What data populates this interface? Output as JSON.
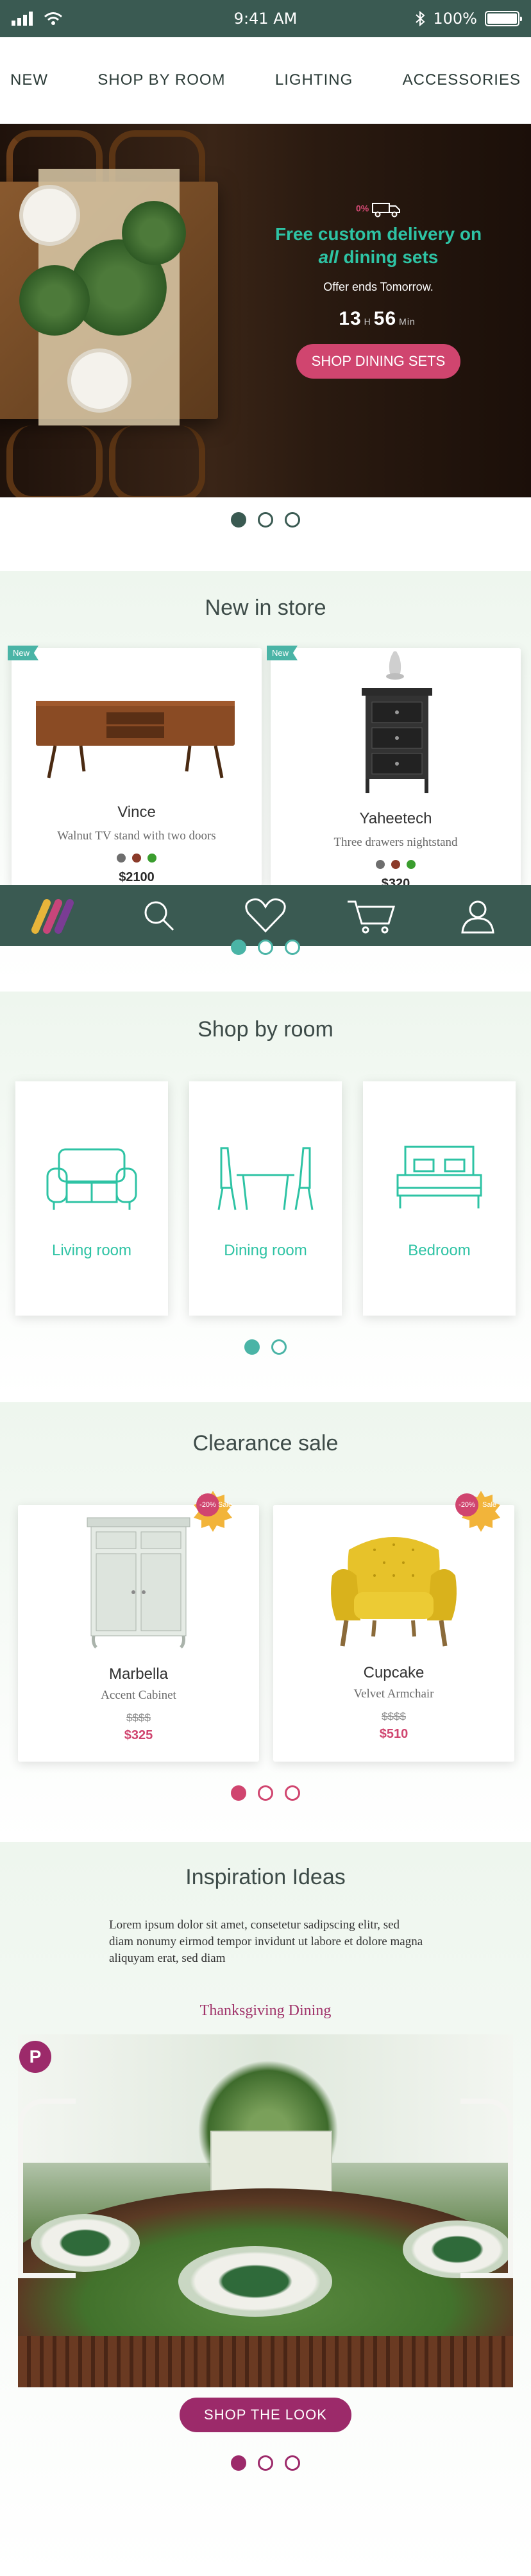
{
  "status_bar": {
    "time": "9:41 AM",
    "battery": "100%"
  },
  "nav": {
    "items": [
      "NEW",
      "SHOP BY ROOM",
      "LIGHTING",
      "ACCESSORIES"
    ]
  },
  "hero": {
    "badge": "0%",
    "headline_line1": "Free custom delivery on",
    "headline_line2_italic": "all",
    "headline_line2_rest": " dining sets",
    "sub": "Offer ends Tomorrow.",
    "hours": "13",
    "hours_unit": "H",
    "minutes": "56",
    "minutes_unit": "Min",
    "cta": "SHOP DINING SETS"
  },
  "new_in_store": {
    "title": "New in store",
    "products": [
      {
        "badge": "New",
        "name": "Vince",
        "desc": "Walnut TV stand with two doors",
        "price": "$2100",
        "swatch_colors": [
          "#6e6e6e",
          "#8b3b2a",
          "#3a9d2e"
        ]
      },
      {
        "badge": "New",
        "name": "Yaheetech",
        "desc": "Three drawers nightstand",
        "price": "$320",
        "swatch_colors": [
          "#6e6e6e",
          "#8b3b2a",
          "#3a9d2e"
        ]
      }
    ]
  },
  "tabbar": {
    "icons": [
      "app-logo-icon",
      "search-icon",
      "heart-icon",
      "cart-icon",
      "user-icon"
    ]
  },
  "shop_by_room": {
    "title": "Shop by room",
    "rooms": [
      {
        "label": "Living room",
        "icon": "sofa-icon"
      },
      {
        "label": "Dining room",
        "icon": "dining-table-icon"
      },
      {
        "label": "Bedroom",
        "icon": "bed-icon"
      }
    ]
  },
  "clearance": {
    "title": "Clearance sale",
    "products": [
      {
        "discount": "-20%",
        "sale_label": "Sale",
        "name": "Marbella",
        "desc": "Accent Cabinet",
        "old_price": "$$$$",
        "price": "$325"
      },
      {
        "discount": "-20%",
        "sale_label": "Sale",
        "name": "Cupcake",
        "desc": "Velvet Armchair",
        "old_price": "$$$$",
        "price": "$510"
      }
    ]
  },
  "inspiration": {
    "title": "Inspiration Ideas",
    "text": "Lorem ipsum dolor sit amet, consetetur sadipscing elitr, sed diam nonumy eirmod tempor invidunt ut labore et dolore magna aliquyam erat, sed diam",
    "subtitle": "Thanksgiving Dining",
    "pin_letter": "P",
    "cta": "SHOP THE LOOK"
  },
  "colors": {
    "primary": "#3a5a52",
    "accent_teal": "#2ec3a4",
    "accent_pink": "#d0456f",
    "accent_plum": "#9c2a6a"
  }
}
